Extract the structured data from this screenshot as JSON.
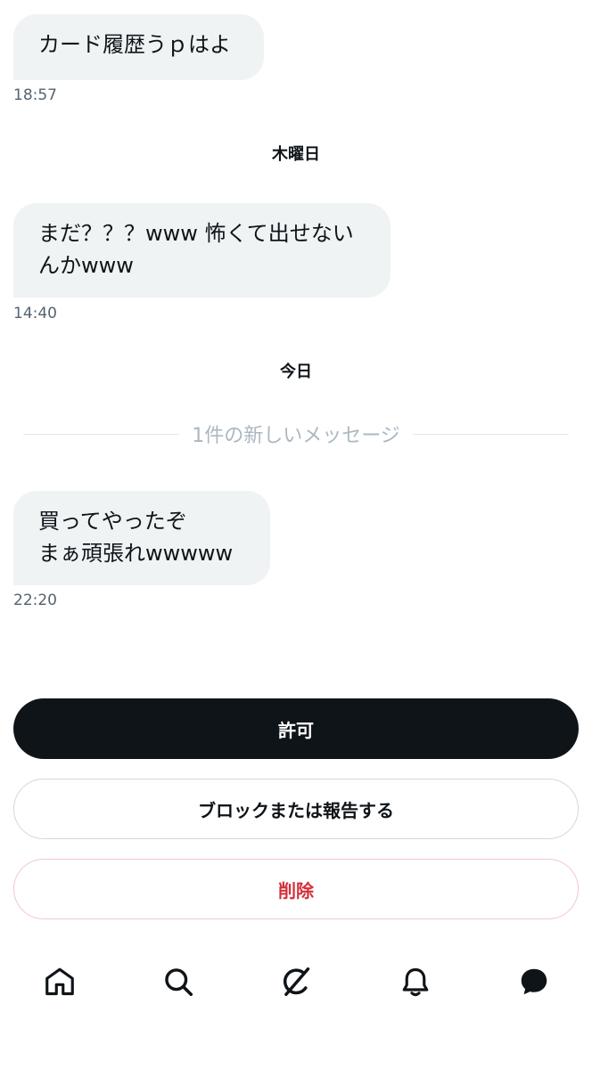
{
  "messages": [
    {
      "lines": [
        "カード履歴うｐはよ"
      ],
      "time": "18:57"
    },
    {
      "lines": [
        "まだ？？？www 怖くて出せない",
        "んかwww"
      ],
      "time": "14:40"
    },
    {
      "lines": [
        "買ってやったぞ",
        "まぁ頑張れwwwww"
      ],
      "time": "22:20"
    }
  ],
  "day_separators": [
    "木曜日",
    "今日"
  ],
  "new_messages_label": "1件の新しいメッセージ",
  "actions": {
    "allow_label": "許可",
    "block_report_label": "ブロックまたは報告する",
    "delete_label": "削除"
  },
  "nav": {
    "items": [
      "home-icon",
      "search-icon",
      "grok-icon",
      "notifications-bell-icon",
      "messages-icon"
    ]
  },
  "colors": {
    "bubble_bg": "#eff3f4",
    "primary_button_bg": "#0f1419",
    "delete_text": "#d3303a",
    "divider_text": "#aab8c2"
  }
}
